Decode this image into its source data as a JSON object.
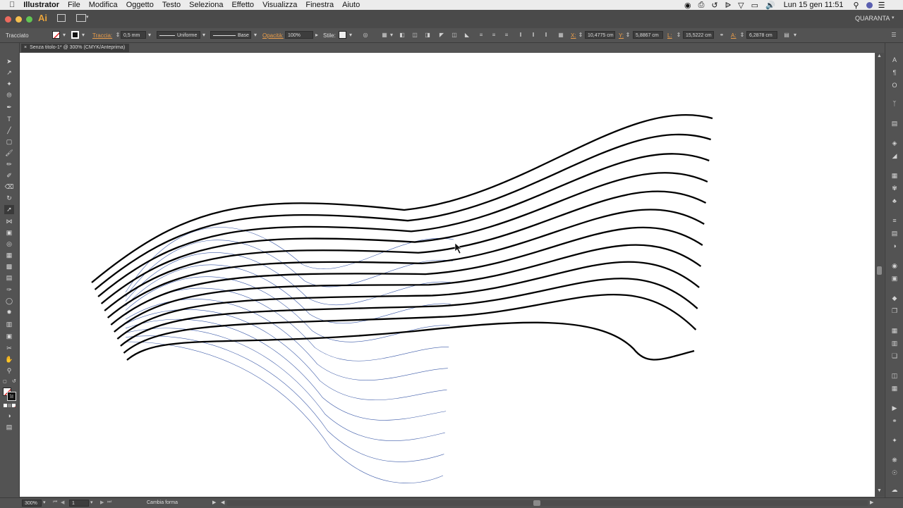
{
  "menubar": {
    "app_name": "Illustrator",
    "items": [
      "File",
      "Modifica",
      "Oggetto",
      "Testo",
      "Seleziona",
      "Effetto",
      "Visualizza",
      "Finestra",
      "Aiuto"
    ],
    "datetime": "Lun 15 gen  11:51"
  },
  "appbar": {
    "logo": "Ai",
    "workspace": "QUARANTA"
  },
  "control": {
    "selection_type": "Tracciato",
    "stroke_label": "Traccia:",
    "stroke_weight": "0,5 mm",
    "profile": "Uniforme",
    "brush": "Base",
    "opacity_label": "Opacità:",
    "opacity": "100%",
    "style_label": "Stile:",
    "x_label": "X:",
    "x_value": "10,4775 cm",
    "y_label": "Y:",
    "y_value": "5,8867 cm",
    "w_label": "L:",
    "w_value": "15,5222 cm",
    "h_label": "A:",
    "h_value": "6,2878 cm"
  },
  "document": {
    "tab_title": "Senza titolo-1* @ 300% (CMYK/Anteprima)"
  },
  "status": {
    "zoom": "300%",
    "artboard": "1",
    "tool_name": "Cambia forma"
  },
  "colors": {
    "ui_dark": "#535353",
    "canvas": "#ffffff",
    "path_black": "#000000",
    "selection_blue": "#3c5aa8"
  }
}
